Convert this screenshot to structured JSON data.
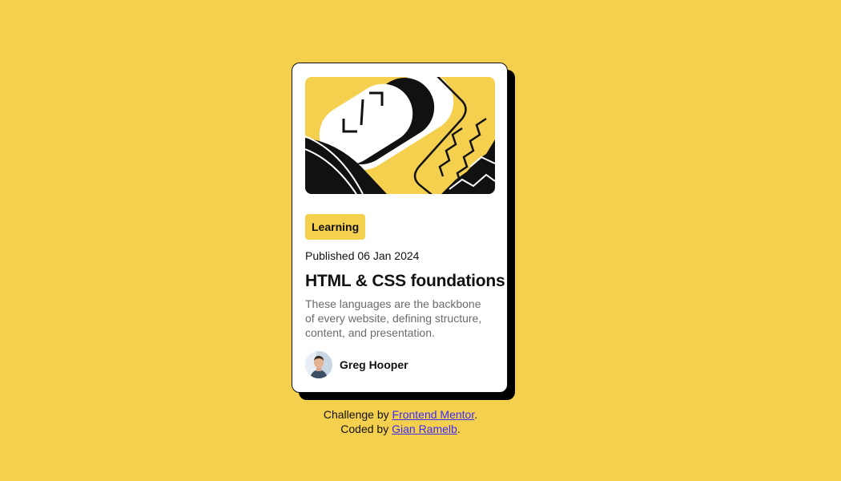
{
  "page": {
    "background_color": "#F4D04E",
    "accent_color": "#F4D04E",
    "text_color": "#111111",
    "muted_text_color": "#6B6B6B",
    "link_color": "#3E2CF5"
  },
  "card": {
    "hero_image": "abstract-illustration",
    "tag": "Learning",
    "published": "Published 06 Jan 2024",
    "title": "HTML & CSS foundations",
    "description": "These languages are the backbone of every website, defining structure, content, and presentation.",
    "author": {
      "avatar": "author-avatar",
      "name": "Greg Hooper"
    }
  },
  "attribution": {
    "line1_prefix": "Challenge by ",
    "line1_link": "Frontend Mentor",
    "line1_suffix": ".",
    "line2_prefix": "Coded by ",
    "line2_link": "Gian Ramelb",
    "line2_suffix": "."
  }
}
